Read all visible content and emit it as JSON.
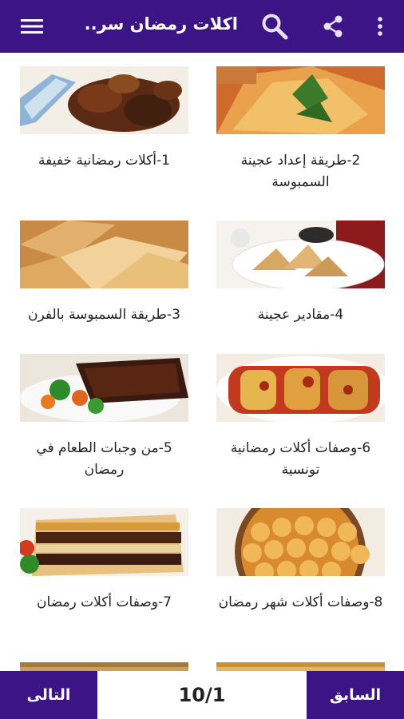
{
  "app_bar": {
    "title": "اكلات رمضان سر...",
    "icons": [
      "menu-icon",
      "search-icon",
      "share-icon",
      "more-vert-icon"
    ],
    "color": "#3d1486"
  },
  "grid": {
    "items": [
      {
        "label": "2-طريقة إعداد عجينة السمبوسة"
      },
      {
        "label": "1-أكلات رمضانية خفيفة"
      },
      {
        "label": "4-مقادير عجينة"
      },
      {
        "label": "3-طريقة السمبوسة بالفرن"
      },
      {
        "label": "6-وصفات أكلات رمضانية تونسية"
      },
      {
        "label": "5-من وجبات الطعام في رمضان"
      },
      {
        "label": "8-وصفات أكلات شهر رمضان"
      },
      {
        "label": "7-وصفات أكلات رمضان"
      }
    ]
  },
  "bottom_bar": {
    "next_label": "التالى",
    "prev_label": "السابق",
    "page_indicator": "10/1"
  }
}
